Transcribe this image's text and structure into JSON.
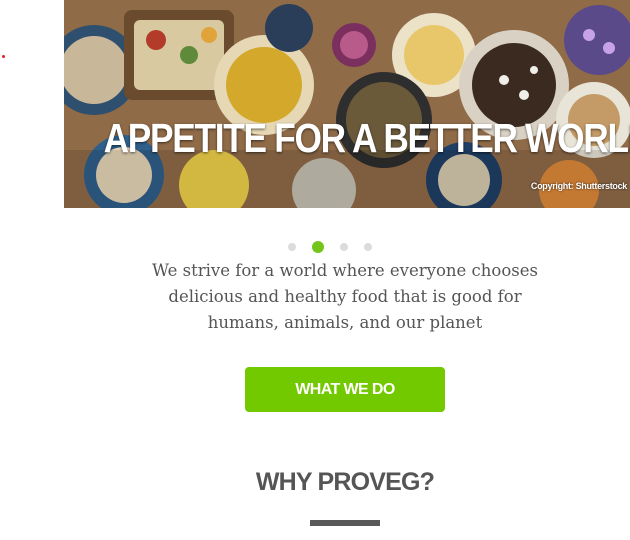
{
  "hero": {
    "title": "APPETITE FOR A BETTER WORLD",
    "copyright": "Copyright: Shutterstock",
    "image": "food-table-photo"
  },
  "carousel": {
    "slide_count": 4,
    "active_index": 1,
    "active_color": "#73c51a",
    "inactive_color": "#dcdcdc"
  },
  "intro": {
    "line1": "We strive for a world where everyone chooses",
    "line2": "delicious and healthy food that is good for",
    "line3": "humans, animals, and our planet"
  },
  "cta": {
    "label": "WHAT WE DO",
    "color": "#73c900"
  },
  "section": {
    "heading": "WHY PROVEG?"
  }
}
